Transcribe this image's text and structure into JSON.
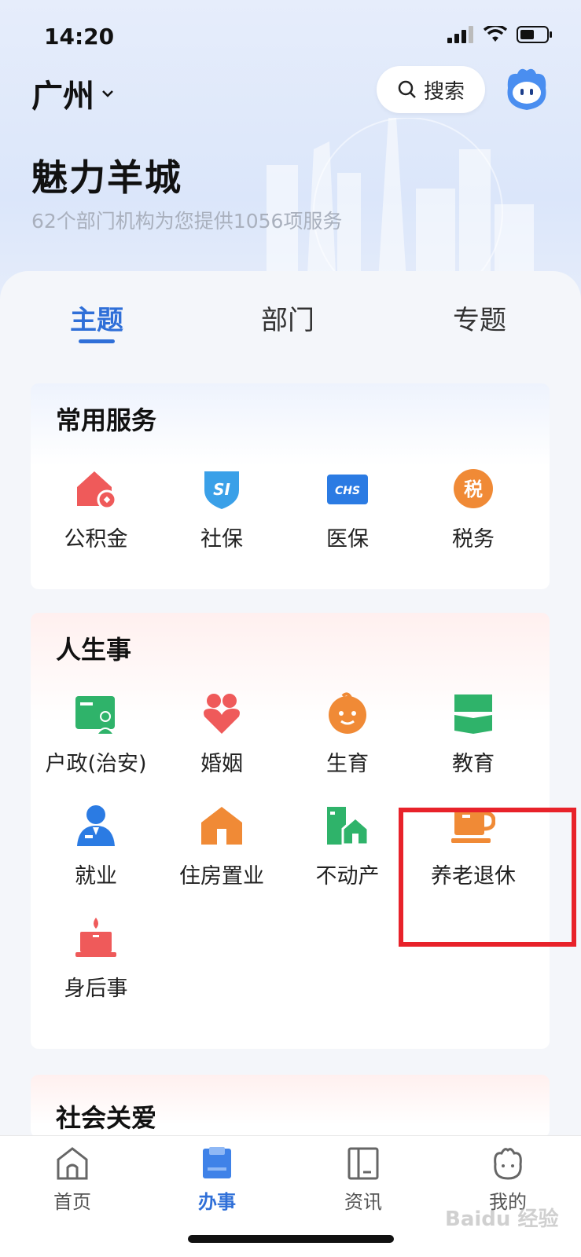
{
  "status": {
    "time": "14:20"
  },
  "header": {
    "city": "广州",
    "search_label": "搜索"
  },
  "hero": {
    "title": "魅力羊城",
    "subtitle": "62个部门机构为您提供1056项服务"
  },
  "tabs": [
    {
      "label": "主题",
      "active": true
    },
    {
      "label": "部门",
      "active": false
    },
    {
      "label": "专题",
      "active": false
    }
  ],
  "common": {
    "title": "常用服务",
    "items": [
      {
        "label": "公积金",
        "icon": "housing-fund-icon"
      },
      {
        "label": "社保",
        "icon": "social-security-icon",
        "badge": "SI"
      },
      {
        "label": "医保",
        "icon": "medical-insurance-icon",
        "badge": "CHS"
      },
      {
        "label": "税务",
        "icon": "tax-icon",
        "badge": "税"
      }
    ]
  },
  "life": {
    "title": "人生事",
    "items": [
      {
        "label": "户政(治安)",
        "icon": "household-icon"
      },
      {
        "label": "婚姻",
        "icon": "marriage-icon"
      },
      {
        "label": "生育",
        "icon": "baby-icon"
      },
      {
        "label": "教育",
        "icon": "book-icon"
      },
      {
        "label": "就业",
        "icon": "employment-icon"
      },
      {
        "label": "住房置业",
        "icon": "house-icon"
      },
      {
        "label": "不动产",
        "icon": "real-estate-icon"
      },
      {
        "label": "养老退休",
        "icon": "coffee-cup-icon"
      },
      {
        "label": "身后事",
        "icon": "candle-icon"
      }
    ]
  },
  "care": {
    "title": "社会关爱"
  },
  "nav": [
    {
      "label": "首页",
      "icon": "home-icon",
      "active": false
    },
    {
      "label": "办事",
      "icon": "task-icon",
      "active": true
    },
    {
      "label": "资讯",
      "icon": "news-icon",
      "active": false
    },
    {
      "label": "我的",
      "icon": "profile-icon",
      "active": false
    }
  ],
  "watermark": "Baidu 经验",
  "colors": {
    "accent": "#2f6fd8",
    "highlight": "#e8222a"
  }
}
